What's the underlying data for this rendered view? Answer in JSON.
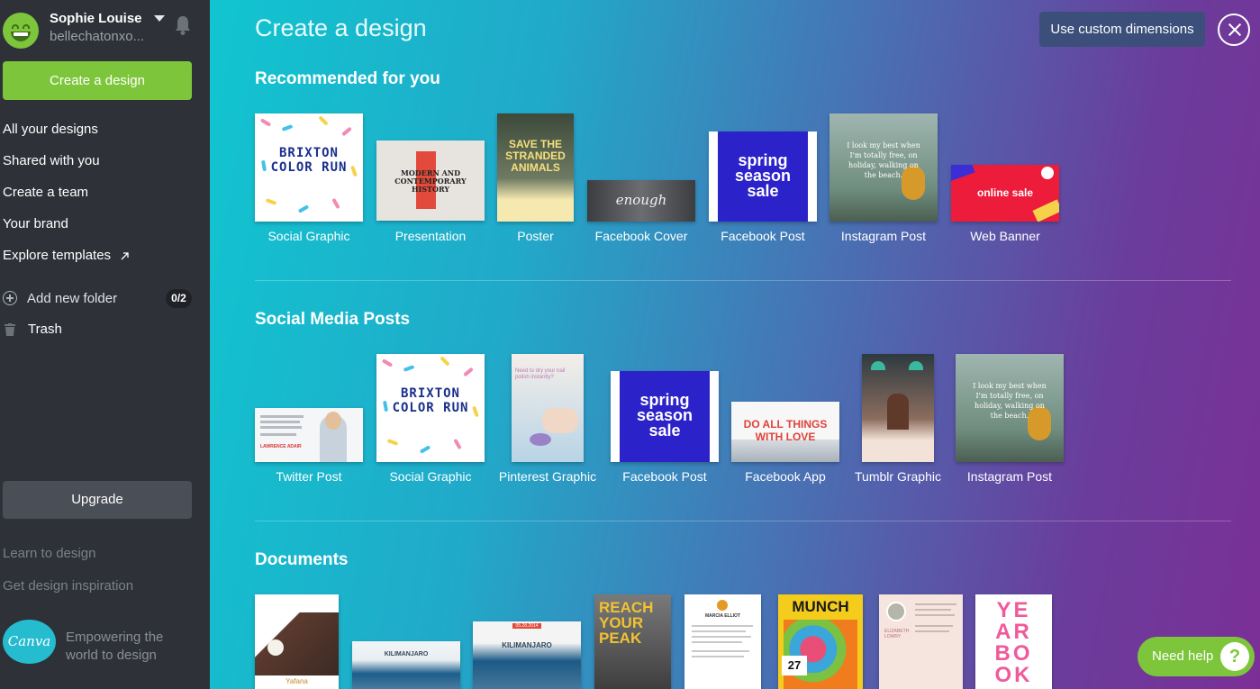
{
  "user": {
    "name": "Sophie Louise",
    "handle": "bellechatonxo..."
  },
  "sidebar": {
    "create_button": "Create a design",
    "nav": [
      {
        "label": "All your designs"
      },
      {
        "label": "Shared with you"
      },
      {
        "label": "Create a team"
      },
      {
        "label": "Your brand"
      },
      {
        "label": "Explore templates"
      }
    ],
    "add_folder": {
      "label": "Add new folder",
      "count": "0/2"
    },
    "trash": {
      "label": "Trash"
    },
    "upgrade": "Upgrade",
    "learn": "Learn to design",
    "inspiration": "Get design inspiration",
    "logo_text": "Canva",
    "tagline": "Empowering the world to design"
  },
  "main": {
    "title": "Create a design",
    "custom_dimensions": "Use custom dimensions",
    "sections": [
      {
        "title": "Recommended for you",
        "items": [
          {
            "label": "Social Graphic"
          },
          {
            "label": "Presentation"
          },
          {
            "label": "Poster"
          },
          {
            "label": "Facebook Cover"
          },
          {
            "label": "Facebook Post"
          },
          {
            "label": "Instagram Post"
          },
          {
            "label": "Web Banner"
          }
        ]
      },
      {
        "title": "Social Media Posts",
        "items": [
          {
            "label": "Twitter Post"
          },
          {
            "label": "Social Graphic"
          },
          {
            "label": "Pinterest Graphic"
          },
          {
            "label": "Facebook Post"
          },
          {
            "label": "Facebook App"
          },
          {
            "label": "Tumblr Graphic"
          },
          {
            "label": "Instagram Post"
          }
        ]
      },
      {
        "title": "Documents",
        "items": []
      }
    ]
  },
  "thumb_text": {
    "brixton": "BRIXTON\nCOLOR RUN",
    "presentation": "MODERN AND\nCONTEMPORARY\nHISTORY",
    "poster": "SAVE THE\nSTRANDED\nANIMALS",
    "fbcover": "enough",
    "spring": "spring\nseason\nsale",
    "instagram": "I look my best when\nI'm totally free, on\nholiday, walking on\nthe beach.",
    "banner": "online sale",
    "fbapp": "DO ALL THINGS\nWITH LOVE",
    "pinterest": "Need to dry your nail\npolish instantly?",
    "twitter_name": "LAWRENCE ADAIR",
    "doc1": "Yafana",
    "doc2": "KILIMANJARO",
    "doc3": "KILIMANJARO",
    "doc3_date": "05.28.2014",
    "doc4": "REACH\nYOUR\nPEAK",
    "doc5": "MARCIA ELLIOT",
    "doc6": "MUNCH",
    "doc6_num": "27",
    "doc7": "ELIZABETH\nLOWRY",
    "doc8": "YE\nAR\nBO\nOK"
  },
  "help": {
    "label": "Need help",
    "icon": "?"
  },
  "colors": {
    "accent_green": "#7dc63b",
    "sidebar_bg": "#2e3138",
    "canva_teal": "#25bccf"
  }
}
